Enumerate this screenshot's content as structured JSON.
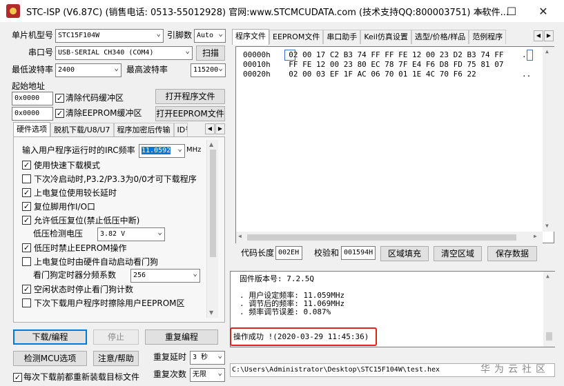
{
  "window": {
    "title": "STC-ISP (V6.87C) (销售电话: 0513-55012928) 官网:www.STCMCUDATA.com  (技术支持QQ:800003751) 本软件...",
    "min_glyph": "—",
    "max_glyph": "☐",
    "close_glyph": "✕"
  },
  "config": {
    "mcu_label": "单片机型号",
    "mcu_value": "STC15F104W",
    "pin_label": "引脚数",
    "pin_value": "Auto",
    "port_label": "串口号",
    "port_value": "USB-SERIAL CH340 (COM4)",
    "scan_button": "扫描",
    "min_baud_label": "最低波特率",
    "min_baud_value": "2400",
    "max_baud_label": "最高波特率",
    "max_baud_value": "115200",
    "start_addr_label": "起始地址",
    "addr1_value": "0x0000",
    "clear_code_label": "清除代码缓冲区",
    "open_program_button": "打开程序文件",
    "addr2_value": "0x0000",
    "clear_eeprom_label": "清除EEPROM缓冲区",
    "open_eeprom_button": "打开EEPROM文件"
  },
  "left_tabs": [
    "硬件选项",
    "脱机下载/U8/U7",
    "程序加密后传输",
    "ID号"
  ],
  "hardware": {
    "irc_label": "输入用户程序运行时的IRC频率",
    "irc_value": "11.0592",
    "irc_unit": "MHz",
    "options": [
      {
        "label": "使用快速下载模式",
        "checked": true
      },
      {
        "label": "下次冷启动时,P3.2/P3.3为0/0才可下载程序",
        "checked": false
      },
      {
        "label": "上电复位使用较长延时",
        "checked": true
      },
      {
        "label": "复位脚用作I/O口",
        "checked": true
      },
      {
        "label": "允许低压复位(禁止低压中断)",
        "checked": true
      }
    ],
    "lvd_label": "低压检测电压",
    "lvd_value": "3.82 V",
    "options2": [
      {
        "label": "低压时禁止EEPROM操作",
        "checked": true
      },
      {
        "label": "上电复位时由硬件自动启动看门狗",
        "checked": false
      }
    ],
    "wdt_label": "看门狗定时器分频系数",
    "wdt_value": "256",
    "options3": [
      {
        "label": "空闲状态时停止看门狗计数",
        "checked": true
      },
      {
        "label": "下次下载用户程序时擦除用户EEPROM区",
        "checked": false
      }
    ]
  },
  "actions": {
    "download": "下载/编程",
    "stop": "停止",
    "reprogram": "重复编程",
    "detect_mcu": "检测MCU选项",
    "help": "注意/帮助",
    "retry_delay_label": "重复延时",
    "retry_delay_value": "3 秒",
    "retry_count_label": "重复次数",
    "retry_count_value": "无限",
    "reload_label": "每次下载前都重新装载目标文件"
  },
  "right_tabs": [
    "程序文件",
    "EEPROM文件",
    "串口助手",
    "Keil仿真设置",
    "选型/价格/样品",
    "范例程序"
  ],
  "hex": {
    "lines": [
      "00000h    02 00 17 C2 B3 74 FF FF FE 12 00 23 D2 B3 74 FF    .",
      "00010h    FF FE 12 00 23 80 EC 78 7F E4 F6 D8 FD 75 81 07",
      "00020h    02 00 03 EF 1F AC 06 70 01 1E 4C 70 F6 22          .."
    ]
  },
  "hex_footer": {
    "code_len_label": "代码长度",
    "code_len_value": "002EH",
    "checksum_label": "校验和",
    "checksum_value": "001594H",
    "fill_button": "区域填充",
    "clear_button": "清空区域",
    "save_button": "保存数据"
  },
  "log": {
    "firmware": "固件版本号: 7.2.5Q",
    "set_freq": ". 用户设定频率: 11.059MHz",
    "adj_freq": ". 调节后的频率: 11.069MHz",
    "err": ". 频率调节误差: 0.087%",
    "success": "操作成功 !(2020-03-29 11:45:36)"
  },
  "path": "C:\\Users\\Administrator\\Desktop\\STC15F104W\\test.hex",
  "watermark": "华为云社区"
}
